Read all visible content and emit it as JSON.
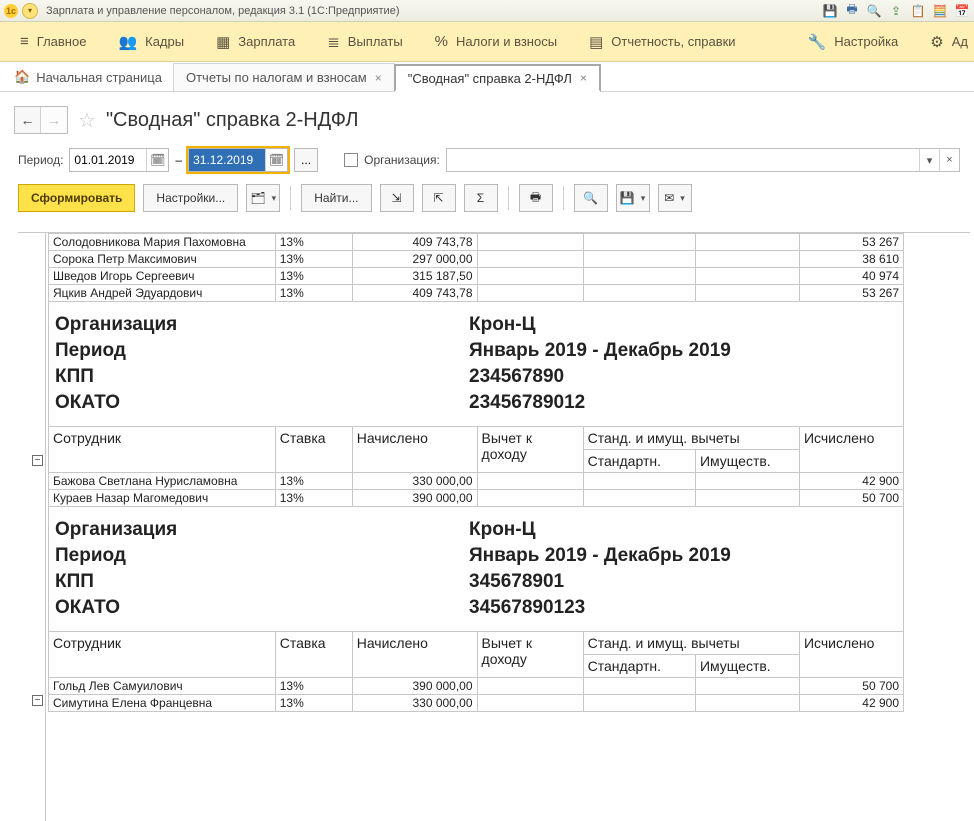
{
  "app_title": "Зарплата и управление персоналом, редакция 3.1  (1С:Предприятие)",
  "mainmenu": {
    "items": [
      {
        "icon": "≡",
        "label": "Главное"
      },
      {
        "icon": "👥",
        "label": "Кадры"
      },
      {
        "icon": "▦",
        "label": "Зарплата"
      },
      {
        "icon": "≣",
        "label": "Выплаты"
      },
      {
        "icon": "%",
        "label": "Налоги и взносы"
      },
      {
        "icon": "▤",
        "label": "Отчетность, справки"
      },
      {
        "icon": "🔧",
        "label": "Настройка"
      },
      {
        "icon": "⚙",
        "label": "Ад"
      }
    ]
  },
  "tabs": {
    "home": "Начальная страница",
    "t1": "Отчеты по налогам и взносам",
    "t2": "\"Сводная\" справка 2-НДФЛ"
  },
  "page_title": "\"Сводная\" справка 2-НДФЛ",
  "filters": {
    "period_label": "Период:",
    "date_from": "01.01.2019",
    "dash": "–",
    "date_to": "31.12.2019",
    "dots": "...",
    "org_label": "Организация:"
  },
  "toolbar": {
    "run": "Сформировать",
    "settings": "Настройки...",
    "find": "Найти..."
  },
  "top_rows": [
    {
      "name": "Солодовникова Мария Пахомовна",
      "rate": "13%",
      "accr": "409 743,78",
      "calc": "53 267"
    },
    {
      "name": "Сорока Петр Максимович",
      "rate": "13%",
      "accr": "297 000,00",
      "calc": "38 610"
    },
    {
      "name": "Шведов Игорь Сергеевич",
      "rate": "13%",
      "accr": "315 187,50",
      "calc": "40 974"
    },
    {
      "name": "Яцкив Андрей Эдуардович",
      "rate": "13%",
      "accr": "409 743,78",
      "calc": "53 267"
    }
  ],
  "group1": {
    "org_l": "Организация",
    "org_v": "Крон-Ц",
    "per_l": "Период",
    "per_v": "Январь 2019 - Декабрь 2019",
    "kpp_l": "КПП",
    "kpp_v": "234567890",
    "okato_l": "ОКАТО",
    "okato_v": "23456789012"
  },
  "headers": {
    "emp": "Сотрудник",
    "rate": "Ставка",
    "accr": "Начислено",
    "ded": "Вычет к доходу",
    "std_imu": "Станд. и имущ. вычеты",
    "std": "Стандартн.",
    "imu": "Имуществ.",
    "calc": "Исчислено"
  },
  "rows1": [
    {
      "name": "Бажова Светлана Нурисламовна",
      "rate": "13%",
      "accr": "330 000,00",
      "calc": "42 900"
    },
    {
      "name": "Кураев Назар Магомедович",
      "rate": "13%",
      "accr": "390 000,00",
      "calc": "50 700"
    }
  ],
  "group2": {
    "org_l": "Организация",
    "org_v": "Крон-Ц",
    "per_l": "Период",
    "per_v": "Январь 2019 - Декабрь 2019",
    "kpp_l": "КПП",
    "kpp_v": "345678901",
    "okato_l": "ОКАТО",
    "okato_v": "34567890123"
  },
  "rows2": [
    {
      "name": "Гольд Лев Самуилович",
      "rate": "13%",
      "accr": "390 000,00",
      "calc": "50 700"
    },
    {
      "name": "Симутина Елена Францевна",
      "rate": "13%",
      "accr": "330 000,00",
      "calc": "42 900"
    }
  ]
}
